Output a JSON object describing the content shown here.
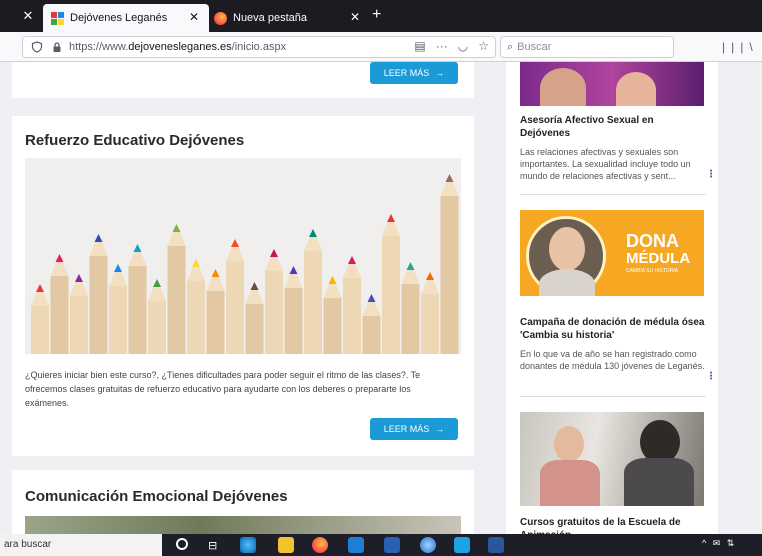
{
  "browser": {
    "active_tab": {
      "title": "Dejóvenes Leganés"
    },
    "inactive_tab": {
      "title": "Nueva pestaña"
    },
    "close_symbol": "✕",
    "new_tab_symbol": "+",
    "url_prefix": "https://www.",
    "url_domain": "dejovenesleganes.es",
    "url_path": "/inicio.aspx",
    "search_placeholder": "Buscar"
  },
  "main": {
    "read_more_label": "LEER MÁS",
    "read_more_arrow": "→",
    "articles": [
      {
        "title": "Refuerzo Educativo Dejóvenes",
        "text": "¿Quieres iniciar bien este curso?, ¿Tienes dificultades para poder seguir el ritmo de las clases?. Te ofrecemos clases gratuitas de refuerzo educativo para ayudarte con los deberes o prepararte los exámenes."
      },
      {
        "title": "Comunicación Emocional Dejóvenes"
      }
    ]
  },
  "sidebar": {
    "items": [
      {
        "title": "Asesoría Afectivo Sexual en Dejóvenes",
        "text": "Las relaciones afectivas y sexuales son importantes. La sexualidad incluye todo un mundo de relaciones afectivas y sent..."
      },
      {
        "title": "Campaña de donación de médula ósea 'Cambia su historia'",
        "text": "En lo que va de año se han registrado como donantes de médula 130 jóvenes de Leganés.",
        "poster": {
          "line1": "DONA",
          "line2": "MÉDULA",
          "line3": "CAMBIA SU HISTORIA"
        }
      },
      {
        "title": "Cursos gratuitos de la Escuela de Animación"
      }
    ],
    "more_symbol": "⋮"
  },
  "taskbar": {
    "search_text": "ara buscar",
    "tray_text": "^ ✉ ⇅"
  },
  "colors": {
    "accent": "#1a9ad6",
    "poster_orange": "#f7a823"
  }
}
